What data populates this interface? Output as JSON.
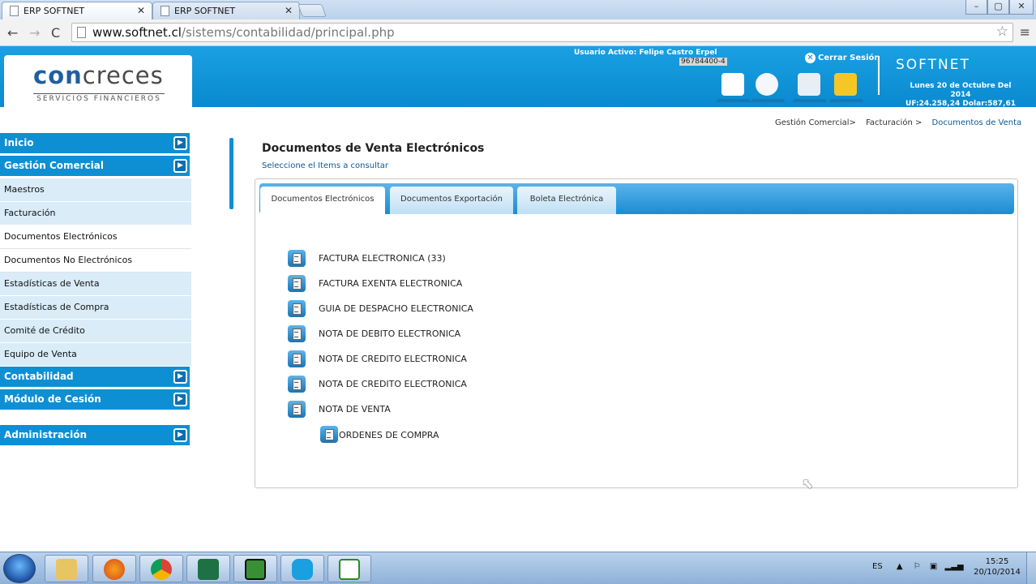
{
  "browser": {
    "tabs": [
      {
        "title": "ERP SOFTNET"
      },
      {
        "title": "ERP SOFTNET"
      }
    ],
    "url_domain": "www.softnet.cl",
    "url_path": "/sistems/contabilidad/principal.php"
  },
  "header": {
    "logo_main_a": "con",
    "logo_main_b": "creces",
    "logo_sub": "SERVICIOS FINANCIEROS",
    "user_label": "Usuario Activo: Felipe Castro Erpel",
    "user_rut": "96784400-4",
    "logout_label": "Cerrar Sesión",
    "brand": "SOFTNET",
    "date_line": "Lunes 20 de Octubre Del 2014",
    "rates_line": "UF:24.258,24 Dolar:587,61",
    "accent_color": "#0a89cf"
  },
  "sidebar": {
    "items": [
      {
        "label": "Inicio",
        "type": "head"
      },
      {
        "label": "Gestión Comercial",
        "type": "head"
      },
      {
        "label": "Maestros",
        "type": "light"
      },
      {
        "label": "Facturación",
        "type": "light"
      },
      {
        "label": "Documentos Electrónicos",
        "type": "white"
      },
      {
        "label": "Documentos No Electrónicos",
        "type": "white"
      },
      {
        "label": "Estadísticas de Venta",
        "type": "light"
      },
      {
        "label": "Estadísticas de Compra",
        "type": "light"
      },
      {
        "label": "Comité de Crédito",
        "type": "light"
      },
      {
        "label": "Equipo de Venta",
        "type": "light"
      },
      {
        "label": "Contabilidad",
        "type": "head"
      },
      {
        "label": "Módulo de Cesión",
        "type": "head"
      },
      {
        "label": "Administración",
        "type": "head"
      }
    ]
  },
  "breadcrumb": {
    "items": [
      "Gestión Comercial>",
      "Facturación >",
      "Documentos de Venta"
    ]
  },
  "main": {
    "title": "Documentos de Venta Electrónicos",
    "subtitle": "Seleccione el Items a consultar",
    "tabs": [
      {
        "label": "Documentos Electrónicos"
      },
      {
        "label": "Documentos Exportación"
      },
      {
        "label": "Boleta Electrónica"
      }
    ],
    "documents": [
      "FACTURA ELECTRONICA (33)",
      "FACTURA EXENTA ELECTRONICA",
      "GUIA DE DESPACHO ELECTRONICA",
      "NOTA DE DEBITO ELECTRONICA",
      "NOTA DE CREDITO ELECTRONICA",
      "NOTA DE CREDITO ELECTRONICA",
      "NOTA DE VENTA"
    ],
    "sub_document": "ORDENES DE COMPRA"
  },
  "taskbar": {
    "language": "ES",
    "time": "15:25",
    "date": "20/10/2014"
  }
}
